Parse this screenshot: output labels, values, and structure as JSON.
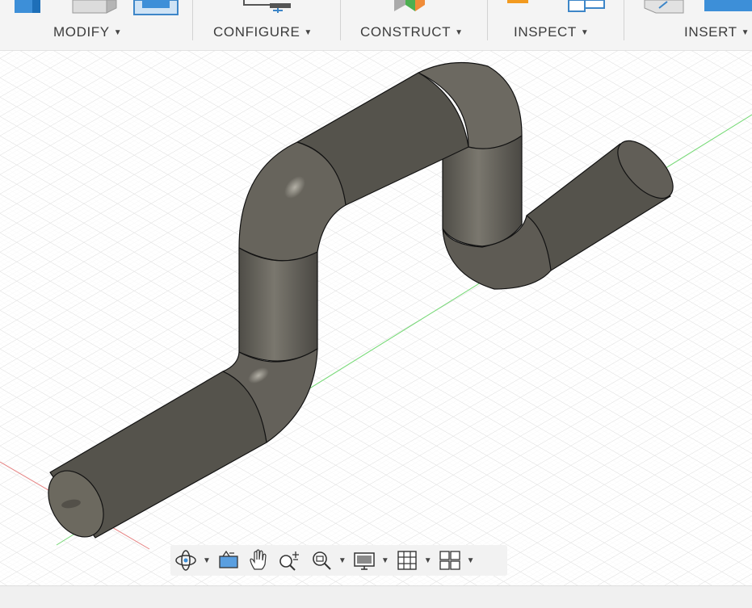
{
  "toolbar": {
    "groups": [
      {
        "label": "MODIFY",
        "caret": "▼"
      },
      {
        "label": "CONFIGURE",
        "caret": "▼"
      },
      {
        "label": "CONSTRUCT",
        "caret": "▼"
      },
      {
        "label": "INSPECT",
        "caret": "▼"
      },
      {
        "label": "INSERT",
        "caret": "▼"
      }
    ]
  },
  "navbar": {
    "caret": "▼",
    "tools": [
      "orbit-icon",
      "look-at-icon",
      "pan-icon",
      "zoom-icon",
      "fit-zoom-icon",
      "display-settings-icon",
      "grid-snap-icon",
      "viewports-icon"
    ]
  },
  "colors": {
    "toolbar_bg": "#f4f4f4",
    "pipe": "#6a675f",
    "grid": "#d8d8d8",
    "x_axis": "#e06060",
    "y_axis": "#62d262"
  }
}
